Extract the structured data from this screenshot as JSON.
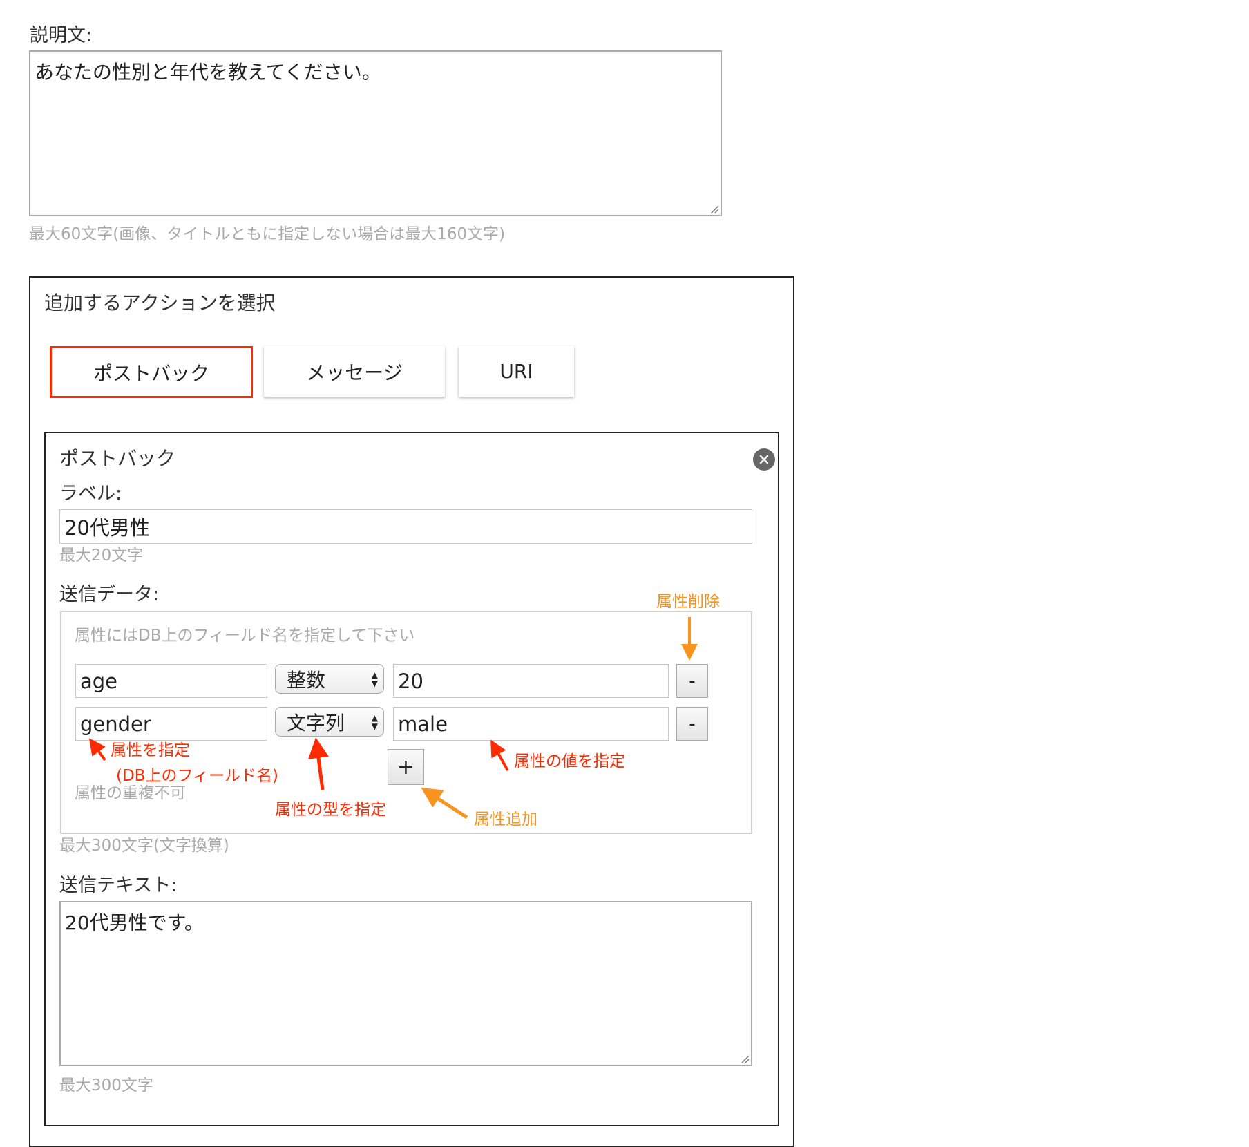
{
  "description": {
    "label": "説明文:",
    "value": "あなたの性別と年代を教えてください。",
    "hint": "最大60文字(画像、タイトルともに指定しない場合は最大160文字)"
  },
  "actions": {
    "title": "追加するアクションを選択",
    "tabs": [
      {
        "label": "ポストバック",
        "selected": true
      },
      {
        "label": "メッセージ",
        "selected": false
      },
      {
        "label": "URI",
        "selected": false
      }
    ]
  },
  "postback": {
    "title": "ポストバック",
    "close_icon": "close-circle-icon",
    "label_field": {
      "label": "ラベル:",
      "value": "20代男性",
      "hint": "最大20文字"
    },
    "send_data": {
      "label": "送信データ:",
      "hint_top": "属性にはDB上のフィールド名を指定して下さい",
      "rows": [
        {
          "attribute": "age",
          "type": "整数",
          "value": "20",
          "remove": "-"
        },
        {
          "attribute": "gender",
          "type": "文字列",
          "value": "male",
          "remove": "-"
        }
      ],
      "add": "+",
      "hint_bottom": "属性の重複不可",
      "limit": "最大300文字(文字換算)"
    },
    "send_text": {
      "label": "送信テキスト:",
      "value": "20代男性です。",
      "hint": "最大300文字"
    }
  },
  "annotations": {
    "remove_attr": "属性削除",
    "specify_attr": "属性を指定",
    "specify_attr_note": "(DB上のフィールド名)",
    "specify_type": "属性の型を指定",
    "add_attr": "属性追加",
    "specify_value": "属性の値を指定"
  },
  "colors": {
    "selected_tab_border": "#ff2a00",
    "annotation_red": "#ff2a00",
    "annotation_orange": "#f7931e"
  }
}
